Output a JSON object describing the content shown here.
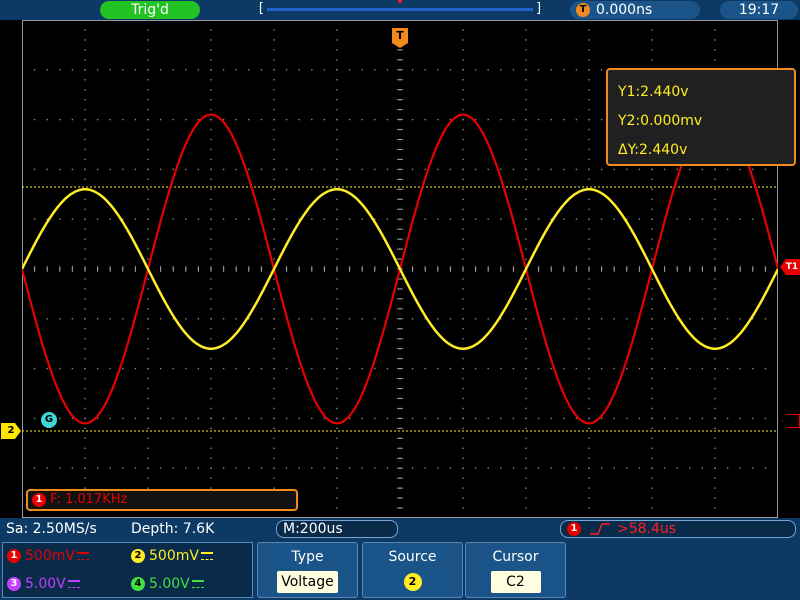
{
  "topbar": {
    "trigger_status": "Trig'd",
    "trigger_time_badge": "T",
    "trigger_time": "0.000ns",
    "clock": "19:17"
  },
  "screen": {
    "trigger_position_marker": "T",
    "trigger_level_marker": "T1",
    "ch2_marker": "2",
    "ground_marker": "G",
    "cursor_readout": {
      "y1": "Y1:2.440v",
      "y2": "Y2:0.000mv",
      "dy": "ΔY:2.440v"
    },
    "frequency": {
      "channel": "1",
      "text": "F: 1.017KHz"
    },
    "colors": {
      "ch1": "#e60000",
      "ch2": "#ffee22",
      "ch3": "#c040ff",
      "ch4": "#40e040",
      "accent": "#f08a1e"
    },
    "waveforms": {
      "ch1": {
        "waveform": "sine",
        "cycles_on_screen": 3.0,
        "amplitude_divisions": 3.1,
        "offset_divisions": 0
      },
      "ch2": {
        "waveform": "sine",
        "cycles_on_screen": 3.0,
        "amplitude_divisions": 1.6,
        "offset_divisions": 0
      }
    }
  },
  "status": {
    "sample_rate": "Sa: 2.50MS/s",
    "depth": "Depth: 7.6K",
    "timebase": "M:200us",
    "trigger_channel": "1",
    "trigger_edge": "rising-edge-icon",
    "trigger_condition": ">58.4us"
  },
  "channels": [
    {
      "num": "1",
      "scale": "500mV"
    },
    {
      "num": "2",
      "scale": "500mV"
    },
    {
      "num": "3",
      "scale": "5.00V"
    },
    {
      "num": "4",
      "scale": "5.00V"
    }
  ],
  "menu": {
    "type": {
      "label": "Type",
      "value": "Voltage"
    },
    "source": {
      "label": "Source",
      "value": "2"
    },
    "cursor": {
      "label": "Cursor",
      "value": "C2"
    }
  }
}
